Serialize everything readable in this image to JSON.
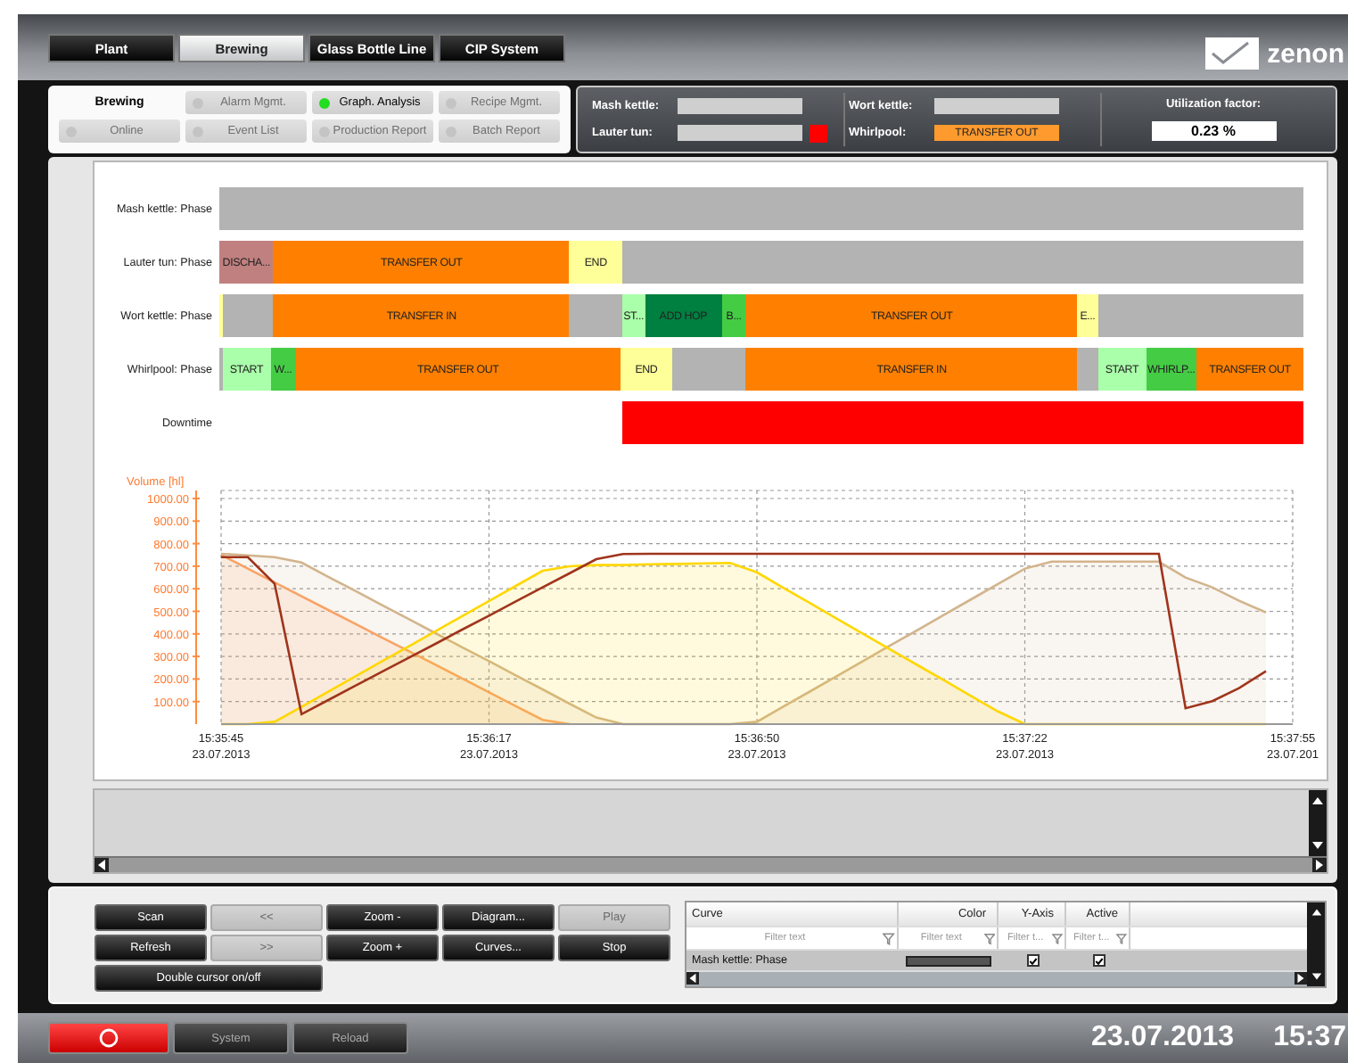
{
  "header": {
    "tabs": [
      {
        "label": "Plant",
        "selected": false
      },
      {
        "label": "Brewing",
        "selected": true
      },
      {
        "label": "Glass Bottle Line",
        "selected": false
      },
      {
        "label": "CIP System",
        "selected": false
      }
    ],
    "logo_text": "zenon"
  },
  "nav": {
    "title": "Brewing",
    "items": [
      {
        "label": "Alarm Mgmt.",
        "selected": false
      },
      {
        "label": "Graph. Analysis",
        "selected": true
      },
      {
        "label": "Recipe Mgmt.",
        "selected": false
      },
      {
        "label": "Online",
        "selected": false
      },
      {
        "label": "Event List",
        "selected": false
      },
      {
        "label": "Production Report",
        "selected": false
      },
      {
        "label": "Batch Report",
        "selected": false
      }
    ]
  },
  "status": {
    "units": [
      {
        "label": "Mash kettle:",
        "color": "#cfcfcf",
        "alarm": false
      },
      {
        "label": "Lauter tun:",
        "color": "#cfcfcf",
        "alarm": true
      },
      {
        "label": "Wort kettle:",
        "color": "#cfcfcf",
        "alarm": false
      },
      {
        "label": "Whirlpool:",
        "value": "TRANSFER OUT",
        "color": "#ff9a2e",
        "alarm": false
      }
    ],
    "utilization": {
      "label": "Utilization factor:",
      "value": "0.23 %"
    }
  },
  "gantt": {
    "rows": [
      {
        "label": "Mash kettle: Phase",
        "segments": [
          {
            "color": "#b3b3b3"
          }
        ]
      },
      {
        "label": "Lauter tun: Phase",
        "segments": [
          {
            "text": "DISCHA...",
            "color": "#c08080"
          },
          {
            "text": "TRANSFER OUT",
            "color": "#ff8000"
          },
          {
            "text": "END",
            "color": "#ffff99"
          },
          {
            "color": "#b3b3b3"
          }
        ]
      },
      {
        "label": "Wort kettle: Phase",
        "segments": [
          {
            "color": "#ffff99"
          },
          {
            "color": "#b3b3b3"
          },
          {
            "text": "TRANSFER IN",
            "color": "#ff8000"
          },
          {
            "color": "#b3b3b3"
          },
          {
            "text": "ST...",
            "color": "#aaffaa"
          },
          {
            "text": "ADD HOP",
            "color": "#008040"
          },
          {
            "text": "B...",
            "color": "#44cc44"
          },
          {
            "text": "TRANSFER OUT",
            "color": "#ff8000"
          },
          {
            "text": "E...",
            "color": "#ffff99"
          },
          {
            "color": "#b3b3b3"
          }
        ]
      },
      {
        "label": "Whirlpool: Phase",
        "segments": [
          {
            "color": "#b3b3b3"
          },
          {
            "text": "START",
            "color": "#aaffaa"
          },
          {
            "text": "W...",
            "color": "#44cc44"
          },
          {
            "text": "TRANSFER OUT",
            "color": "#ff8000"
          },
          {
            "text": "END",
            "color": "#ffff99"
          },
          {
            "color": "#b3b3b3"
          },
          {
            "text": "TRANSFER IN",
            "color": "#ff8000"
          },
          {
            "color": "#b3b3b3"
          },
          {
            "text": "START",
            "color": "#aaffaa"
          },
          {
            "text": "WHIRLP...",
            "color": "#44cc44"
          },
          {
            "text": "TRANSFER OUT",
            "color": "#ff8000"
          }
        ]
      },
      {
        "label": "Downtime",
        "segments": [
          {
            "color": "#ff0000"
          }
        ]
      }
    ]
  },
  "chart": {
    "chart_data": {
      "type": "area",
      "ylabel": "Volume [hl]",
      "ylim": [
        0,
        1000
      ],
      "categories": [
        "15:35:45\n23.07.2013",
        null,
        null,
        null,
        null,
        null,
        null,
        null,
        null,
        null,
        "15:36:17\n23.07.2013",
        null,
        null,
        null,
        null,
        null,
        null,
        null,
        null,
        null,
        "15:36:50\n23.07.2013",
        null,
        null,
        null,
        null,
        null,
        null,
        null,
        null,
        null,
        "15:37:22\n23.07.2013",
        null,
        null,
        null,
        null,
        null,
        null,
        null,
        null,
        null,
        "15:37:55\n23.07.201"
      ],
      "series": [
        {
          "color": "#ffa060",
          "values": [
            750,
            689,
            628,
            567,
            506,
            445,
            384,
            323,
            263,
            202,
            141,
            80,
            19,
            0,
            null,
            null,
            null,
            null,
            null,
            null,
            null,
            null,
            null,
            null,
            null,
            null,
            null,
            null,
            null,
            null,
            null,
            null,
            null,
            null,
            null,
            null,
            null,
            null,
            null,
            null,
            null
          ]
        },
        {
          "color": "#d2b48c",
          "values": [
            755,
            748,
            740,
            716,
            653,
            591,
            528,
            466,
            403,
            341,
            279,
            216,
            154,
            91,
            29,
            0,
            0,
            0,
            0,
            0,
            10,
            78,
            146,
            214,
            282,
            350,
            417,
            485,
            553,
            621,
            689,
            720,
            720,
            720,
            720,
            720,
            650,
            606,
            547,
            495,
            null
          ]
        },
        {
          "color": "#ffd700",
          "values": [
            0,
            0,
            10,
            77,
            144,
            211,
            278,
            345,
            412,
            479,
            546,
            613,
            680,
            700,
            705,
            705,
            708,
            710,
            712,
            715,
            673,
            603,
            535,
            466,
            398,
            330,
            261,
            193,
            124,
            56,
            0,
            0,
            0,
            0,
            0,
            0,
            0,
            0,
            0,
            0,
            null
          ]
        },
        {
          "color": "#a0341c",
          "type": "line",
          "values": [
            740,
            740,
            622,
            44,
            107,
            169,
            232,
            294,
            356,
            419,
            481,
            544,
            606,
            668,
            731,
            754,
            755,
            755,
            755,
            755,
            755,
            755,
            755,
            755,
            755,
            755,
            755,
            755,
            755,
            755,
            755,
            755,
            755,
            755,
            755,
            755,
            70,
            102,
            160,
            235,
            null
          ]
        }
      ],
      "grid": true,
      "yticks": [
        {
          "value": 100,
          "label": "100.00"
        },
        {
          "value": 200,
          "label": "200.00"
        },
        {
          "value": 300,
          "label": "300.00"
        },
        {
          "value": 400,
          "label": "400.00"
        },
        {
          "value": 500,
          "label": "500.00"
        },
        {
          "value": 600,
          "label": "600.00"
        },
        {
          "value": 700,
          "label": "700.00"
        },
        {
          "value": 800,
          "label": "800.00"
        },
        {
          "value": 900,
          "label": "900.00"
        },
        {
          "value": 1000,
          "label": "1000.00"
        }
      ]
    }
  },
  "controls": {
    "buttons": [
      {
        "label": "Scan",
        "disabled": false
      },
      {
        "label": "<<",
        "disabled": true
      },
      {
        "label": "Zoom -",
        "disabled": false
      },
      {
        "label": "Diagram...",
        "disabled": false
      },
      {
        "label": "Play",
        "disabled": true
      },
      {
        "label": "Refresh",
        "disabled": false
      },
      {
        "label": ">>",
        "disabled": true
      },
      {
        "label": "Zoom +",
        "disabled": false
      },
      {
        "label": "Curves...",
        "disabled": false
      },
      {
        "label": "Stop",
        "disabled": false
      }
    ],
    "toggle_button": "Double cursor on/off",
    "curves": {
      "columns": [
        {
          "label": "Curve",
          "placeholder": "Filter text"
        },
        {
          "label": "Color",
          "placeholder": "Filter text"
        },
        {
          "label": "Y-Axis",
          "placeholder": "Filter t..."
        },
        {
          "label": "Active",
          "placeholder": "Filter t..."
        }
      ],
      "rows": [
        {
          "curve": "Mash kettle: Phase",
          "color": "#555555",
          "y_axis": true,
          "active": true,
          "selected": true
        }
      ]
    }
  },
  "footer": {
    "buttons": [
      {
        "kind": "alarm"
      },
      {
        "kind": "text",
        "label": "System"
      },
      {
        "kind": "text",
        "label": "Reload"
      }
    ],
    "date": "23.07.2013",
    "time": "15:37"
  }
}
